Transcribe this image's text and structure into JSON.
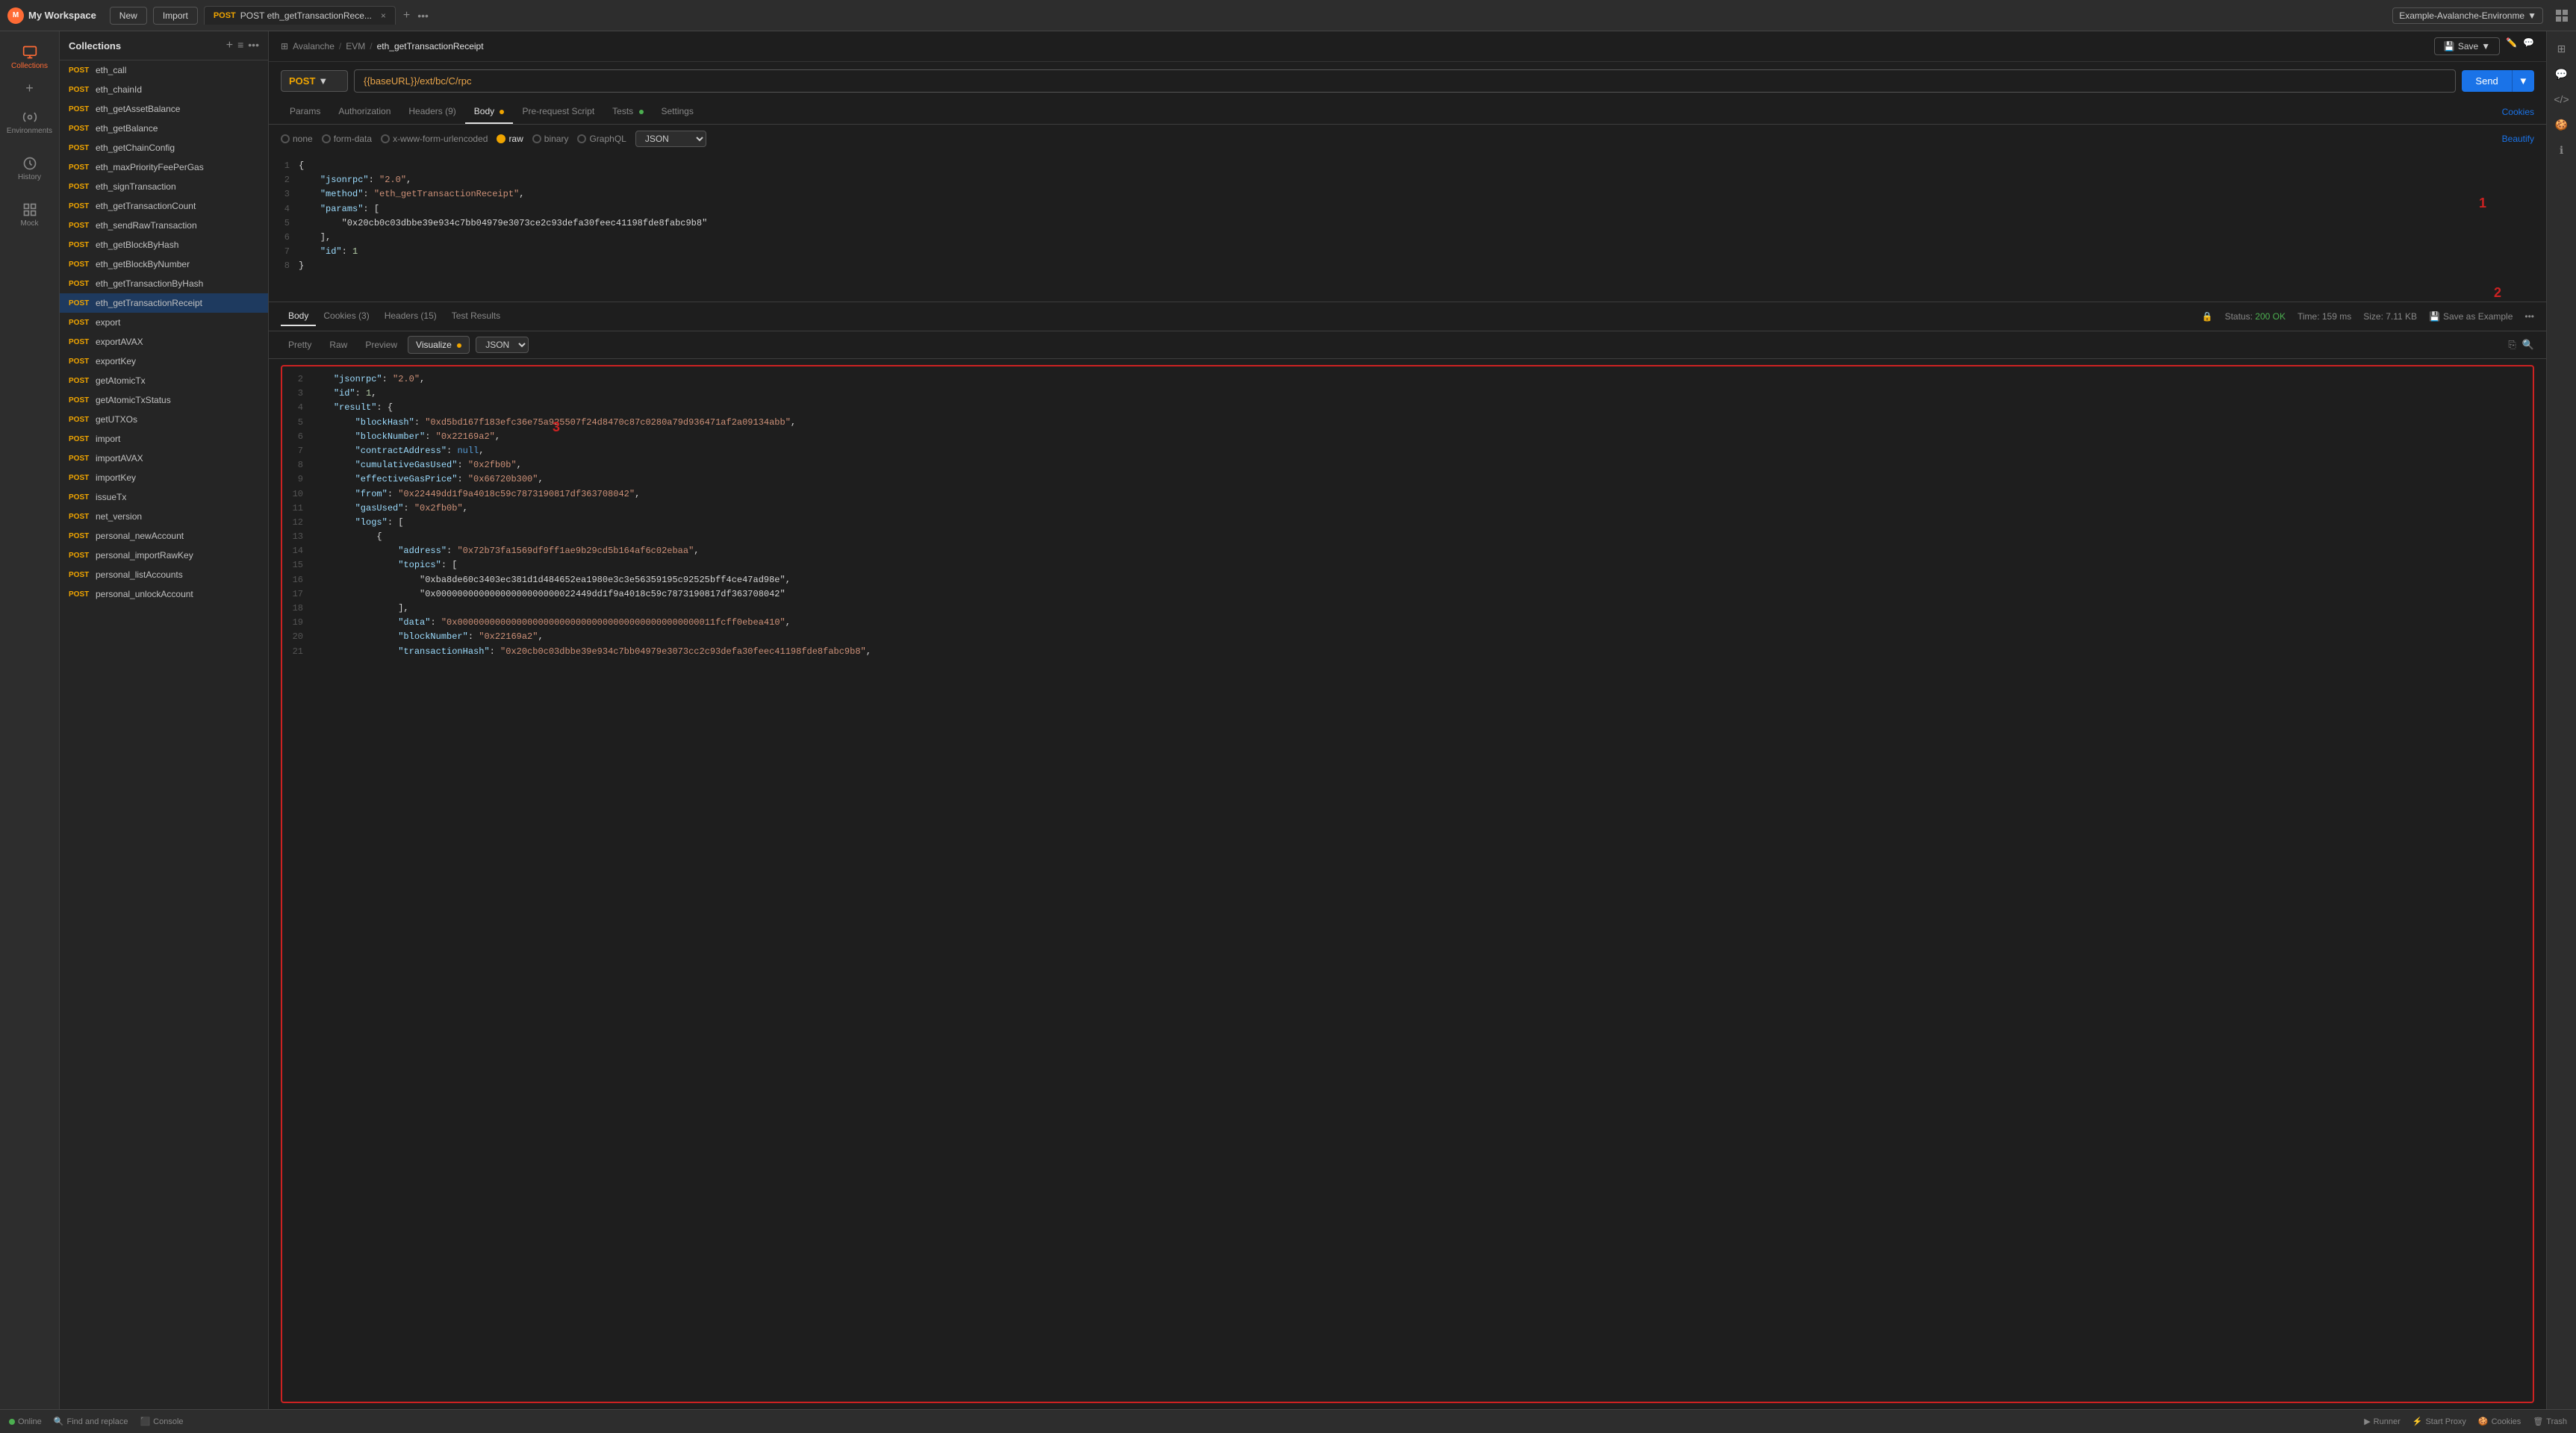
{
  "app": {
    "title": "My Workspace",
    "avatar": "M"
  },
  "top_bar": {
    "new_label": "New",
    "import_label": "Import",
    "active_tab": "POST eth_getTransactionRece...",
    "tab_method": "POST",
    "env_name": "Example-Avalanche-Environme",
    "add_icon": "+",
    "more_icon": "•••"
  },
  "sidebar": {
    "collections_label": "Collections",
    "environments_label": "Environments",
    "history_label": "History",
    "mock_label": "Mock"
  },
  "collections_panel": {
    "title": "Collections",
    "items": [
      {
        "method": "POST",
        "name": "eth_call"
      },
      {
        "method": "POST",
        "name": "eth_chainId"
      },
      {
        "method": "POST",
        "name": "eth_getAssetBalance"
      },
      {
        "method": "POST",
        "name": "eth_getBalance"
      },
      {
        "method": "POST",
        "name": "eth_getChainConfig"
      },
      {
        "method": "POST",
        "name": "eth_maxPriorityFeePerGas"
      },
      {
        "method": "POST",
        "name": "eth_signTransaction"
      },
      {
        "method": "POST",
        "name": "eth_getTransactionCount"
      },
      {
        "method": "POST",
        "name": "eth_sendRawTransaction"
      },
      {
        "method": "POST",
        "name": "eth_getBlockByHash"
      },
      {
        "method": "POST",
        "name": "eth_getBlockByNumber"
      },
      {
        "method": "POST",
        "name": "eth_getTransactionByHash"
      },
      {
        "method": "POST",
        "name": "eth_getTransactionReceipt",
        "active": true
      },
      {
        "method": "POST",
        "name": "export"
      },
      {
        "method": "POST",
        "name": "exportAVAX"
      },
      {
        "method": "POST",
        "name": "exportKey"
      },
      {
        "method": "POST",
        "name": "getAtomicTx"
      },
      {
        "method": "POST",
        "name": "getAtomicTxStatus"
      },
      {
        "method": "POST",
        "name": "getUTXOs"
      },
      {
        "method": "POST",
        "name": "import"
      },
      {
        "method": "POST",
        "name": "importAVAX"
      },
      {
        "method": "POST",
        "name": "importKey"
      },
      {
        "method": "POST",
        "name": "issueTx"
      },
      {
        "method": "POST",
        "name": "net_version"
      },
      {
        "method": "POST",
        "name": "personal_newAccount"
      },
      {
        "method": "POST",
        "name": "personal_importRawKey"
      },
      {
        "method": "POST",
        "name": "personal_listAccounts"
      },
      {
        "method": "POST",
        "name": "personal_unlockAccount"
      }
    ]
  },
  "request": {
    "breadcrumb_1": "Avalanche",
    "breadcrumb_2": "EVM",
    "breadcrumb_current": "eth_getTransactionReceipt",
    "save_label": "Save",
    "method": "POST",
    "url": "{{baseURL}}/ext/bc/C/rpc",
    "send_label": "Send",
    "tabs": [
      {
        "label": "Params",
        "active": false
      },
      {
        "label": "Authorization",
        "active": false
      },
      {
        "label": "Headers (9)",
        "active": false
      },
      {
        "label": "Body",
        "active": true,
        "dot": true,
        "dot_color": "orange"
      },
      {
        "label": "Pre-request Script",
        "active": false
      },
      {
        "label": "Tests",
        "active": false,
        "dot": true,
        "dot_color": "green"
      },
      {
        "label": "Settings",
        "active": false
      }
    ],
    "cookies_label": "Cookies",
    "body_options": [
      "none",
      "form-data",
      "x-www-form-urlencoded",
      "raw",
      "binary",
      "GraphQL"
    ],
    "body_active": "raw",
    "format": "JSON",
    "beautify_label": "Beautify",
    "body_lines": [
      {
        "num": 1,
        "content": "{"
      },
      {
        "num": 2,
        "content": "    \"jsonrpc\": \"2.0\","
      },
      {
        "num": 3,
        "content": "    \"method\": \"eth_getTransactionReceipt\","
      },
      {
        "num": 4,
        "content": "    \"params\": ["
      },
      {
        "num": 5,
        "content": "        \"0x20cb0c03dbbe39e934c7bb04979e3073ce2c93defa30feec41198fde8fabc9b8\""
      },
      {
        "num": 6,
        "content": "    ],"
      },
      {
        "num": 7,
        "content": "    \"id\": 1"
      },
      {
        "num": 8,
        "content": "}"
      }
    ]
  },
  "response": {
    "tabs": [
      {
        "label": "Body",
        "active": true
      },
      {
        "label": "Cookies (3)",
        "active": false
      },
      {
        "label": "Headers (15)",
        "active": false
      },
      {
        "label": "Test Results",
        "active": false
      }
    ],
    "status": "200 OK",
    "time": "159 ms",
    "size": "7.11 KB",
    "save_example": "Save as Example",
    "body_tabs": [
      {
        "label": "Pretty",
        "active": false
      },
      {
        "label": "Raw",
        "active": false
      },
      {
        "label": "Preview",
        "active": false
      },
      {
        "label": "Visualize",
        "active": true,
        "dot": true
      }
    ],
    "format": "JSON",
    "lines": [
      {
        "num": 2,
        "content": "    \"jsonrpc\": \"2.0\","
      },
      {
        "num": 3,
        "content": "    \"id\": 1,"
      },
      {
        "num": 4,
        "content": "    \"result\": {"
      },
      {
        "num": 5,
        "content": "        \"blockHash\": \"0xd5bd167f183efc36e75a925507f24d8470c87c0280a79d936471af2a09134abb\","
      },
      {
        "num": 6,
        "content": "        \"blockNumber\": \"0x22169a2\","
      },
      {
        "num": 7,
        "content": "        \"contractAddress\": null,"
      },
      {
        "num": 8,
        "content": "        \"cumulativeGasUsed\": \"0x2fb0b\","
      },
      {
        "num": 9,
        "content": "        \"effectiveGasPrice\": \"0x66720b300\","
      },
      {
        "num": 10,
        "content": "        \"from\": \"0x22449dd1f9a4018c59c7873190817df363708042\","
      },
      {
        "num": 11,
        "content": "        \"gasUsed\": \"0x2fb0b\","
      },
      {
        "num": 12,
        "content": "        \"logs\": ["
      },
      {
        "num": 13,
        "content": "            {"
      },
      {
        "num": 14,
        "content": "                \"address\": \"0x72b73fa1569df9ff1ae9b29cd5b164af6c02ebaa\","
      },
      {
        "num": 15,
        "content": "                \"topics\": ["
      },
      {
        "num": 16,
        "content": "                    \"0xba8de60c3403ec381d1d484652ea1980e3c3e56359195c92525bff4ce47ad98e\","
      },
      {
        "num": 17,
        "content": "                    \"0x00000000000000000000000022449dd1f9a4018c59c7873190817df363708042\""
      },
      {
        "num": 18,
        "content": "                ],"
      },
      {
        "num": 19,
        "content": "                \"data\": \"0x000000000000000000000000000000000000000000000011fcff0ebea410\","
      },
      {
        "num": 20,
        "content": "                \"blockNumber\": \"0x22169a2\","
      },
      {
        "num": 21,
        "content": "                \"transactionHash\": \"0x20cb0c03dbbe39e934c7bb04979e3073cc2c93defa30feec41198fde8fabc9b8\","
      }
    ],
    "annotation_1": "1",
    "annotation_2": "2",
    "annotation_3": "3"
  },
  "bottom_bar": {
    "online_label": "Online",
    "find_replace_label": "Find and replace",
    "console_label": "Console",
    "runner_label": "Runner",
    "start_proxy_label": "Start Proxy",
    "cookies_label": "Cookies",
    "trash_label": "Trash"
  }
}
